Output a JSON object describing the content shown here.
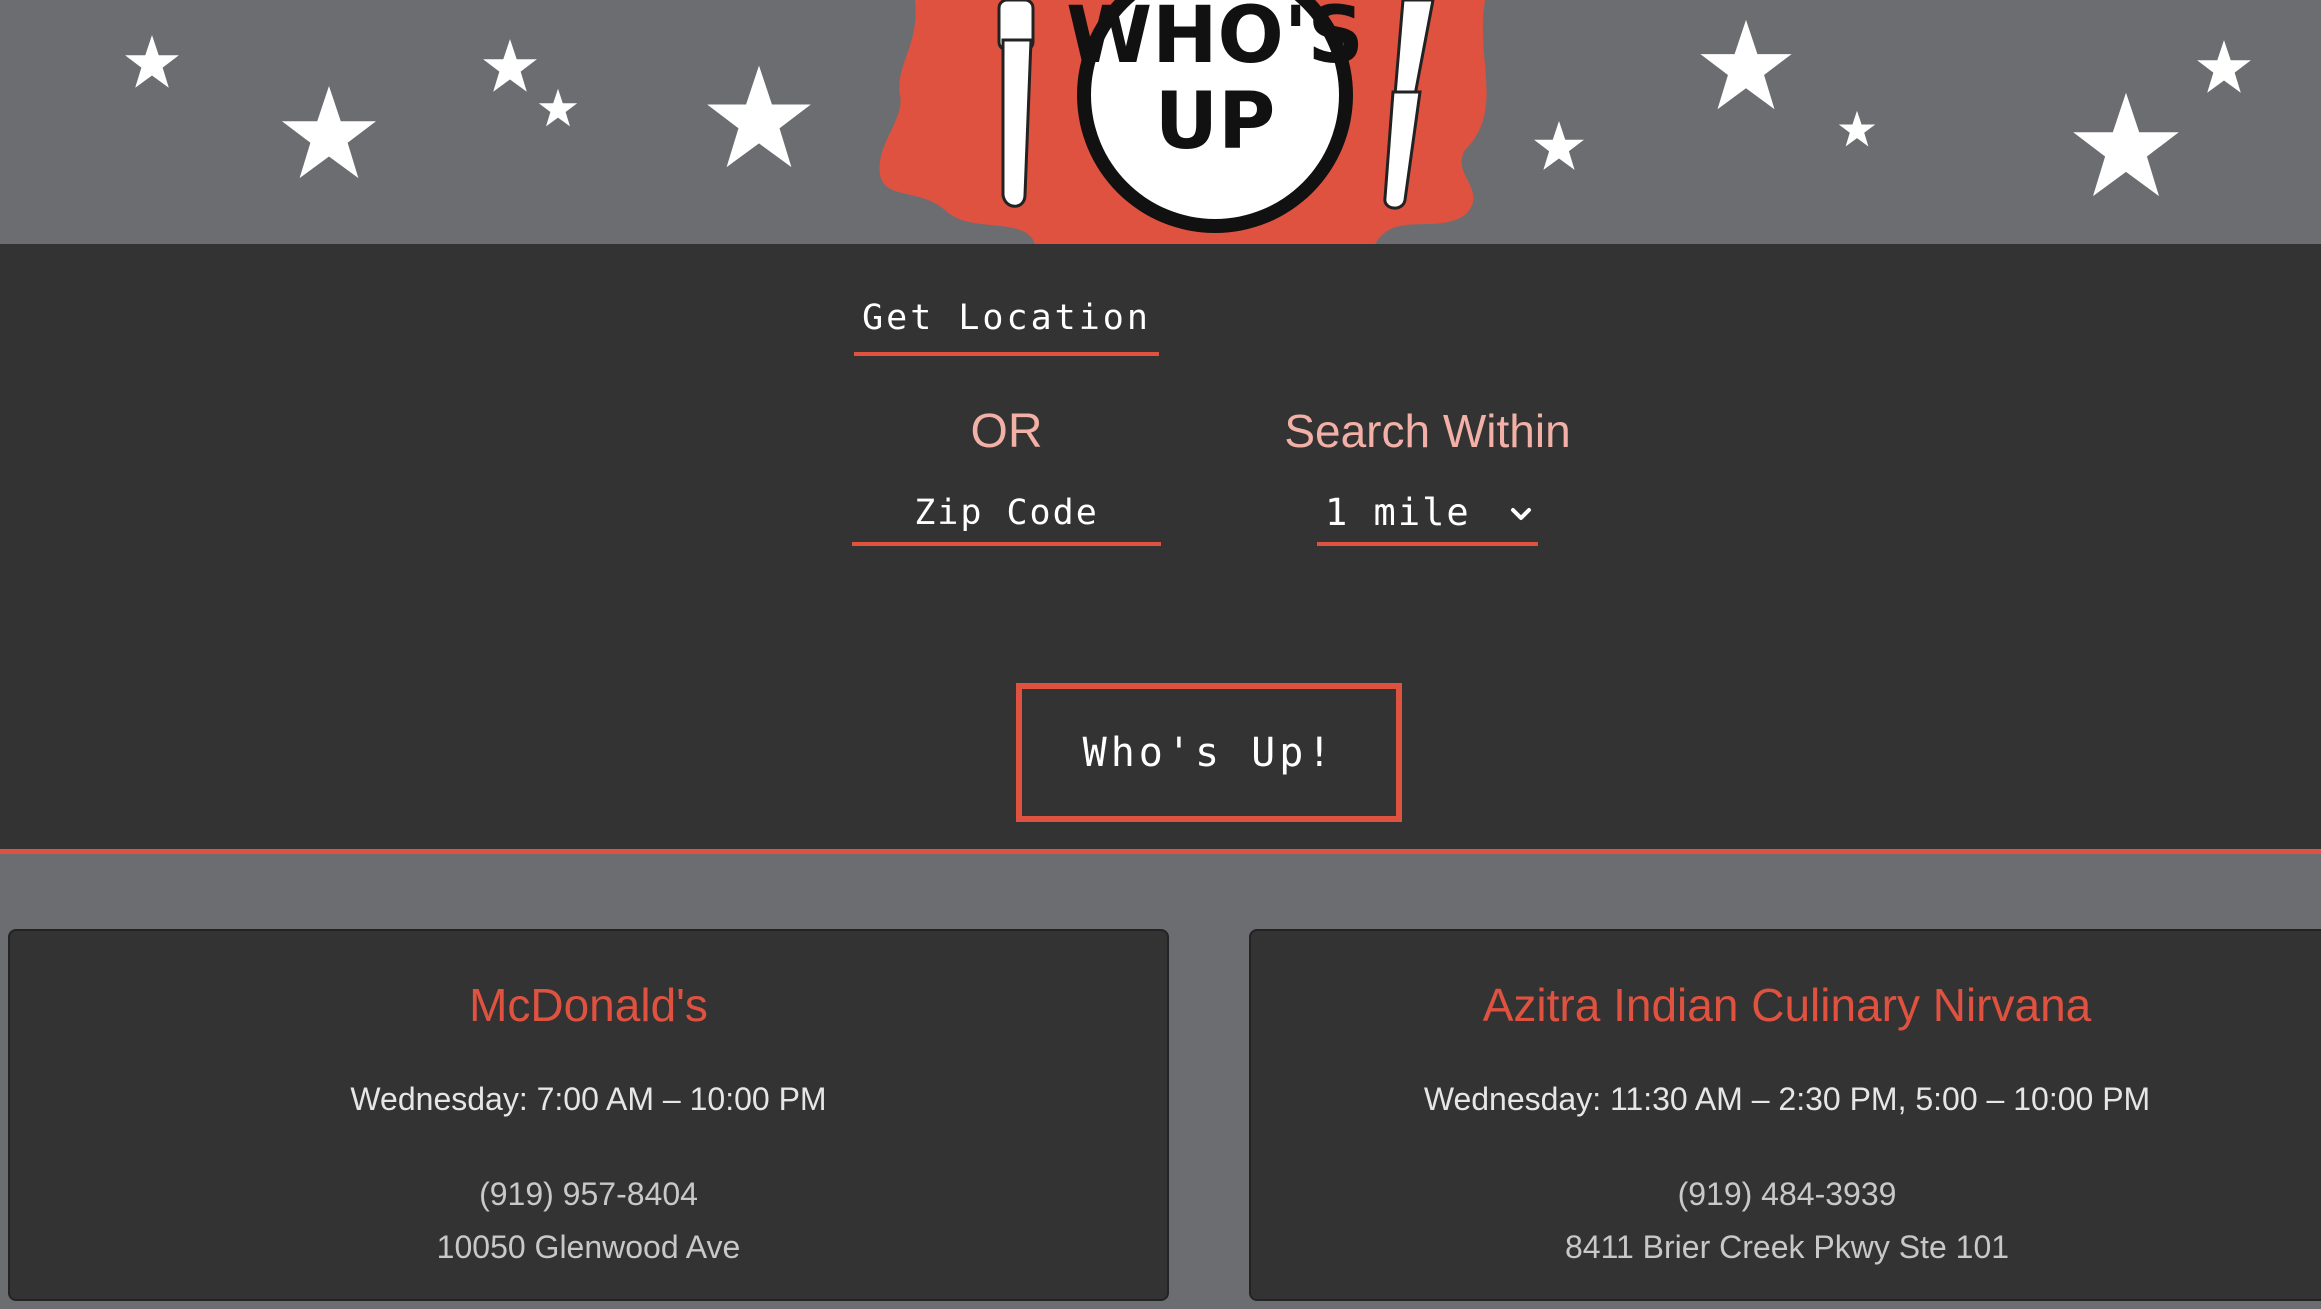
{
  "header": {
    "logo_text_line1": "WHO'S",
    "logo_text_line2": "UP",
    "logo_icons": [
      "fork-icon",
      "knife-icon",
      "star-icon"
    ]
  },
  "search": {
    "get_location_label": "Get Location",
    "or_label": "OR",
    "zip_placeholder": "Zip Code",
    "zip_value": "",
    "search_within_label": "Search Within",
    "radius_selected": "1 mile",
    "submit_label": "Who's Up!"
  },
  "results": [
    {
      "name": "McDonald's",
      "hours": "Wednesday: 7:00 AM – 10:00 PM",
      "phone": "(919) 957-8404",
      "address": "10050 Glenwood Ave"
    },
    {
      "name": "Azitra Indian Culinary Nirvana",
      "hours": "Wednesday: 11:30 AM – 2:30 PM, 5:00 – 10:00 PM",
      "phone": "(919) 484-3939",
      "address": "8411 Brier Creek Pkwy Ste 101"
    }
  ],
  "colors": {
    "accent": "#e05240",
    "accent_light": "#f2b0a6",
    "panel": "#333333",
    "background": "#6c6d71",
    "text": "#ffffff"
  }
}
